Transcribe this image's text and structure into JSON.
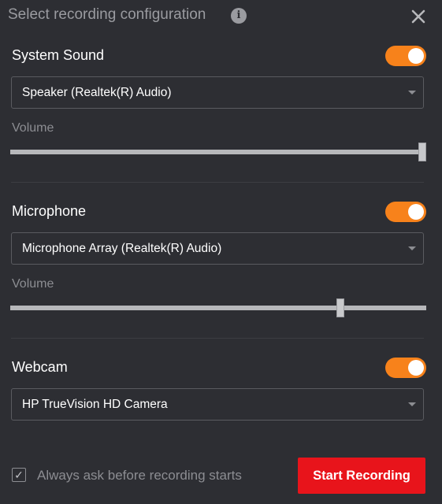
{
  "header": {
    "title": "Select recording configuration",
    "info_icon_glyph": "i"
  },
  "system_sound": {
    "label": "System Sound",
    "enabled": true,
    "device": "Speaker (Realtek(R) Audio)",
    "volume_label": "Volume",
    "volume_level": 1.0
  },
  "microphone": {
    "label": "Microphone",
    "enabled": true,
    "device": "Microphone Array (Realtek(R) Audio)",
    "volume_label": "Volume",
    "volume_level": 0.8
  },
  "webcam": {
    "label": "Webcam",
    "enabled": true,
    "device": "HP TrueVision HD Camera"
  },
  "footer": {
    "always_ask_label": "Always ask before recording starts",
    "always_ask_checked": true,
    "check_glyph": "✓",
    "start_button_label": "Start Recording"
  },
  "colors": {
    "background": "#2d2e33",
    "toggle_on": "#f7821b",
    "start_button": "#e8141b",
    "muted_text": "#8c8d92"
  },
  "icons": {
    "info": "info-icon",
    "close": "close-icon",
    "dropdown": "chevron-down-icon",
    "checkbox": "checkmark-icon"
  }
}
